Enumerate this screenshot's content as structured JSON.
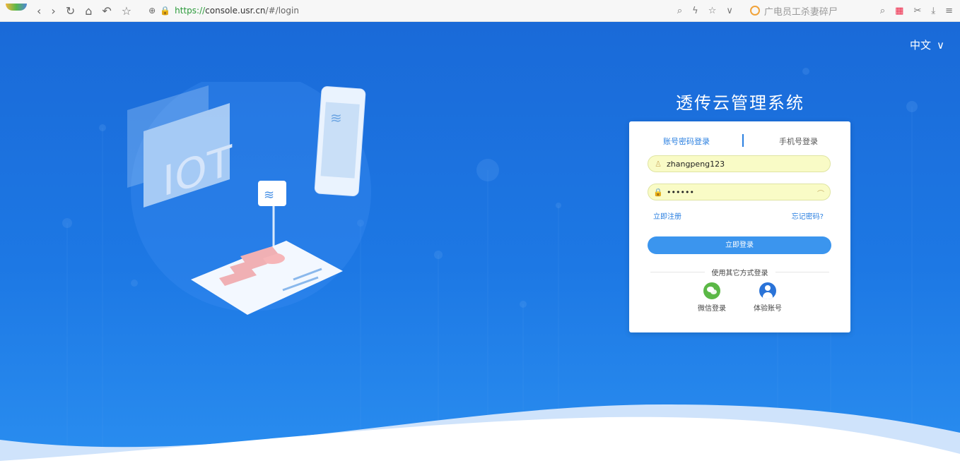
{
  "browser": {
    "url_prefix": "https://",
    "url_host": "console.usr.cn",
    "url_path": "/#/login",
    "search_text": "广电员工杀妻碎尸"
  },
  "page": {
    "language": "中文",
    "system_title": "透传云管理系统",
    "tabs": [
      {
        "label": "账号密码登录",
        "active": true
      },
      {
        "label": "手机号登录",
        "active": false
      }
    ],
    "username_value": "zhangpeng123",
    "password_value": "••••••",
    "register_link": "立即注册",
    "forgot_link": "忘记密码?",
    "login_button": "立即登录",
    "other_login_text": "使用其它方式登录",
    "wechat_login": "微信登录",
    "trial_account": "体验账号"
  },
  "colors": {
    "primary": "#2a7fe0",
    "button": "#3b95ee",
    "bg_blue": "#1a6fd8",
    "input_bg": "#f9fbc6",
    "wechat": "#5bb846"
  }
}
